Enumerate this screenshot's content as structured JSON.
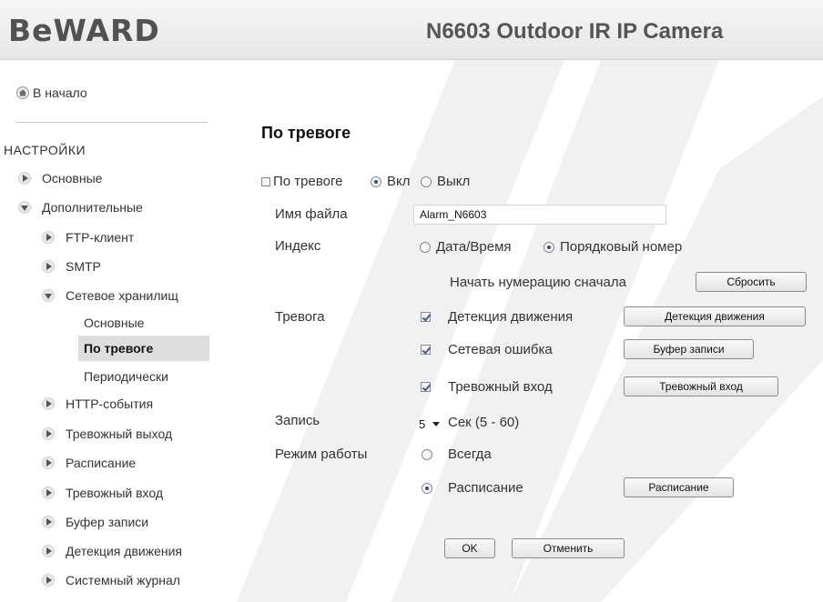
{
  "header": {
    "logo": "BeWARD",
    "title": "N6603 Outdoor IR IP Camera"
  },
  "sidebar": {
    "home": "В начало",
    "section": "НАСТРОЙКИ",
    "items": {
      "basic": "Основные",
      "advanced": "Дополнительные",
      "ftp": "FTP-клиент",
      "smtp": "SMTP",
      "nas": "Сетевое хранилищ",
      "nas_basic": "Основные",
      "nas_alarm": "По тревоге",
      "nas_periodic": "Периодически",
      "http": "HTTP-события",
      "alarm_out": "Тревожный выход",
      "schedule": "Расписание",
      "alarm_in": "Тревожный вход",
      "buffer": "Буфер записи",
      "motion": "Детекция движения",
      "syslog": "Системный журнал"
    }
  },
  "main": {
    "title": "По тревоге",
    "alarm_toggle": {
      "label": "По тревоге",
      "on": "Вкл",
      "off": "Выкл",
      "value": "on"
    },
    "filename": {
      "label": "Имя файла",
      "value": "Alarm_N6603"
    },
    "index": {
      "label": "Индекс",
      "date_time": "Дата/Время",
      "sequence": "Порядковый номер",
      "value": "sequence",
      "restart_label": "Начать нумерацию сначала",
      "reset_button": "Сбросить"
    },
    "alarm": {
      "label": "Тревога",
      "motion": "Детекция движения",
      "motion_button": "Детекция движения",
      "net_error": "Сетевая ошибка",
      "buffer_button": "Буфер записи",
      "alarm_input": "Тревожный вход",
      "alarm_input_button": "Тревожный вход"
    },
    "record": {
      "label": "Запись",
      "value": "5",
      "unit": "Сек (5 - 60)"
    },
    "mode": {
      "label": "Режим работы",
      "always": "Всегда",
      "schedule": "Расписание",
      "value": "schedule",
      "schedule_button": "Расписание"
    },
    "ok_button": "OK",
    "cancel_button": "Отменить"
  },
  "colors": {
    "header_bg": "#ececec",
    "active_item_bg": "#dedede",
    "text": "#333333"
  },
  "icons": {
    "home": "home-icon",
    "nav_arrow": "chevron-right-icon",
    "nav_arrow_open": "chevron-down-icon"
  }
}
